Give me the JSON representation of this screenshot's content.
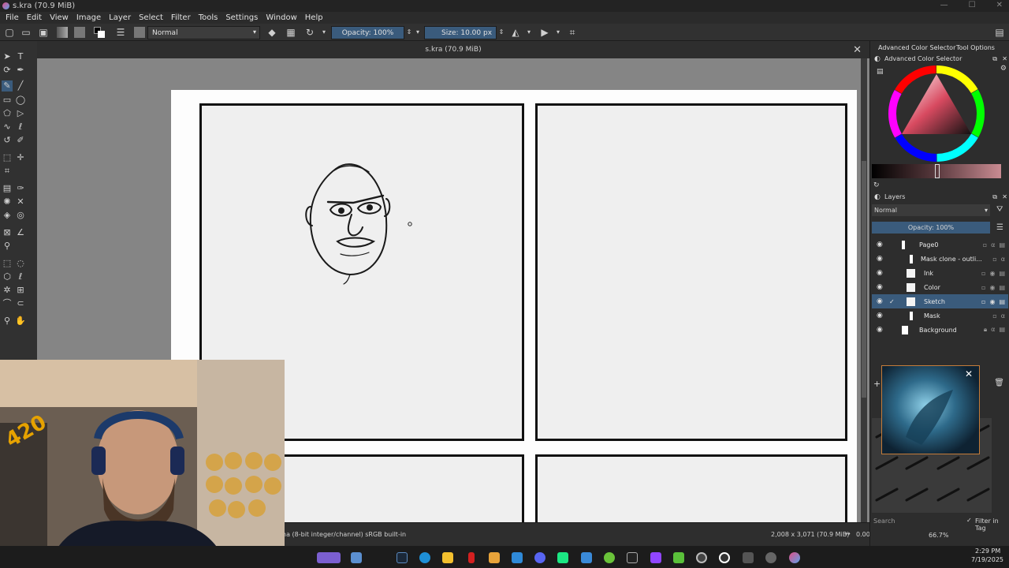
{
  "window": {
    "title": "s.kra (70.9 MiB)"
  },
  "menu": [
    "File",
    "Edit",
    "View",
    "Image",
    "Layer",
    "Select",
    "Filter",
    "Tools",
    "Settings",
    "Window",
    "Help"
  ],
  "toolbar": {
    "blend_mode": "Normal",
    "opacity": "Opacity: 100%",
    "size": "Size: 10.00 px"
  },
  "document": {
    "tab_title": "s.kra (70.9 MiB)"
  },
  "status": {
    "color_profile": "ha (8-bit integer/channel)  sRGB built-in",
    "dimensions": "2,008 x 3,071 (70.9 MiB)",
    "rotation": "0.00°",
    "zoom": "66.7%"
  },
  "dock": {
    "tabs": [
      "Advanced Color Selector",
      "Tool Options"
    ],
    "color_selector_header": "Advanced Color Selector",
    "layers_header": "Layers",
    "layers_blend": "Normal",
    "layers_opacity": "Opacity:  100%",
    "layers": [
      {
        "name": "Page0",
        "selected": false
      },
      {
        "name": "Mask clone - outli...",
        "selected": false
      },
      {
        "name": "Ink",
        "selected": false
      },
      {
        "name": "Color",
        "selected": false
      },
      {
        "name": "Sketch",
        "selected": true
      },
      {
        "name": "Mask",
        "selected": false
      },
      {
        "name": "Background",
        "selected": false
      }
    ],
    "brush_search_placeholder": "Search",
    "filter_in_tag": "Filter in Tag"
  },
  "clock": {
    "time": "2:29 PM",
    "date": "7/19/2025"
  },
  "webcam": {
    "sign_text": "420"
  },
  "colors": {
    "accent": "#3a5b7c",
    "panel_bg": "#2d2d2d",
    "canvas_bg": "#858585"
  }
}
